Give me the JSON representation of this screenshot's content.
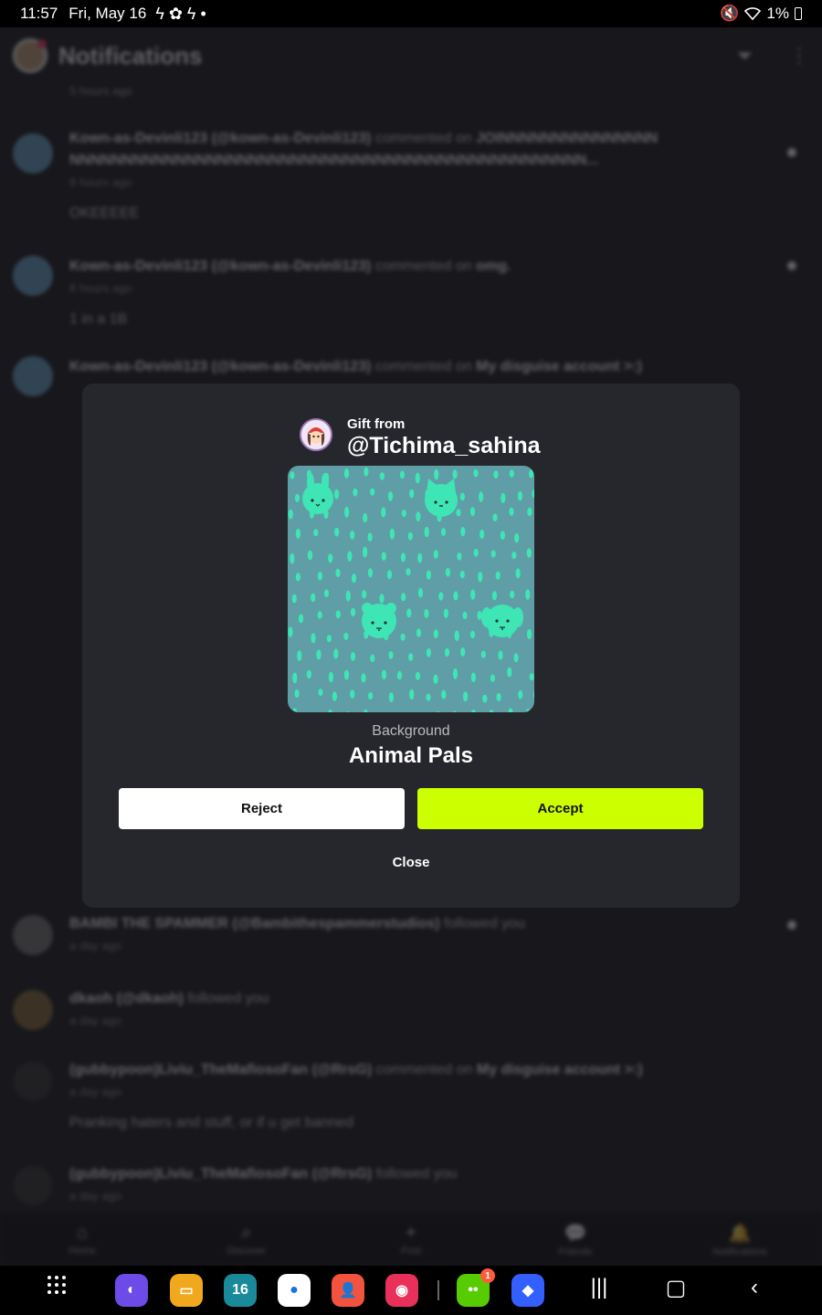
{
  "status_bar": {
    "time": "11:57",
    "date": "Fri, May 16",
    "icons": "ϟ ✿ ϟ •",
    "battery": "1%"
  },
  "app": {
    "title": "Notifications",
    "first_time": "5 hours ago",
    "notifications": [
      {
        "user": "Kown-as-Devinli123 (@kown-as-Devinli123)",
        "action": "commented on",
        "target": "JOINNNNNNNNNNNNNNN NNNNNNNNNNNNNNNNNNNNNNNNNNNNNNNNNNNNNNNNNNNNNNNNN...",
        "time": "8 hours ago",
        "body": "OKEEEEE"
      },
      {
        "user": "Kown-as-Devinli123 (@kown-as-Devinli123)",
        "action": "commented on",
        "target": "omg.",
        "time": "8 hours ago",
        "body": "1 in a 1B"
      },
      {
        "user": "Kown-as-Devinli123 (@kown-as-Devinli123)",
        "action": "commented on",
        "target": "My disguise account >:)",
        "time": "",
        "body": ""
      },
      {
        "user": "BAMBI THE SPAMMER (@Bambithespammerstudios)",
        "action": "followed you",
        "target": "",
        "time": "a day ago",
        "body": ""
      },
      {
        "user": "dkaoh (@dkaoh)",
        "action": "followed you",
        "target": "",
        "time": "a day ago",
        "body": ""
      },
      {
        "user": "(gubbypoon)Liviu_TheMafiosoFan (@RrsG)",
        "action": "commented on",
        "target": "My disguise account >:)",
        "time": "a day ago",
        "body": "Pranking haters and stuff, or if u get banned"
      },
      {
        "user": "(gubbypoon)Liviu_TheMafiosoFan (@RrsG)",
        "action": "followed you",
        "target": "",
        "time": "a day ago",
        "body": ""
      }
    ],
    "tabs": [
      "Home",
      "Discover",
      "Post",
      "Friends",
      "Notifications"
    ]
  },
  "gift_modal": {
    "gift_from_label": "Gift from",
    "username": "@Tichima_sahina",
    "item_type": "Background",
    "item_name": "Animal Pals",
    "reject_label": "Reject",
    "accept_label": "Accept",
    "close_label": "Close",
    "accent_color": "#ccff00",
    "preview_bg_color": "#5f9ea6",
    "preview_pattern_color": "#3ee6b5"
  },
  "system_nav": {
    "calendar_day": "16",
    "duolingo_badge": "1"
  }
}
